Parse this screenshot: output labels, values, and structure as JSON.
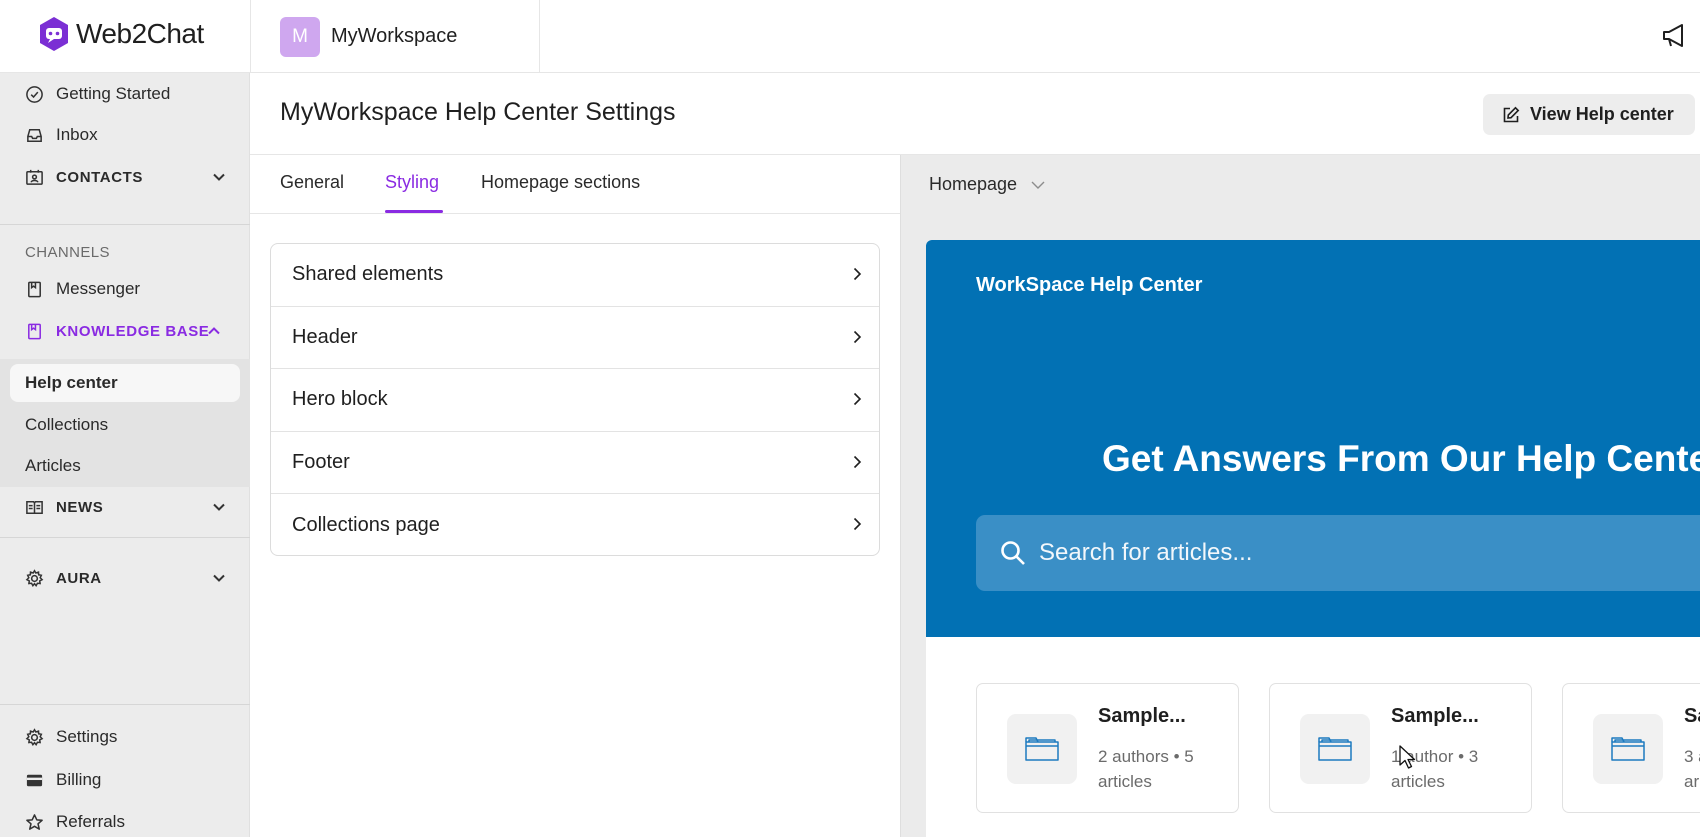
{
  "brand": {
    "logo_text": "Web2Chat",
    "accent": "#8a2be2"
  },
  "workspace": {
    "avatar_letter": "M",
    "name": "MyWorkspace",
    "avatar_color": "#cfa7ef"
  },
  "sidebar": {
    "items": [
      {
        "label": "Getting Started",
        "icon": "check-circle-icon"
      },
      {
        "label": "Inbox",
        "icon": "inbox-icon"
      },
      {
        "label": "CONTACTS",
        "icon": "contacts-icon"
      }
    ],
    "channels_label": "CHANNELS",
    "messenger": {
      "label": "Messenger",
      "icon": "book-icon"
    },
    "knowledge_base": {
      "label": "KNOWLEDGE BASE",
      "icon": "book-icon"
    },
    "kb_sub": [
      {
        "label": "Help center",
        "active": true
      },
      {
        "label": "Collections",
        "active": false
      },
      {
        "label": "Articles",
        "active": false
      }
    ],
    "news": {
      "label": "NEWS",
      "icon": "newspaper-icon"
    },
    "aura": {
      "label": "AURA",
      "icon": "gear-icon"
    },
    "bottom": [
      {
        "label": "Settings",
        "icon": "gear-icon"
      },
      {
        "label": "Billing",
        "icon": "credit-card-icon"
      },
      {
        "label": "Referrals",
        "icon": "star-icon"
      }
    ]
  },
  "header": {
    "title": "MyWorkspace Help Center Settings",
    "view_button": "View Help center"
  },
  "tabs": [
    {
      "label": "General",
      "active": false
    },
    {
      "label": "Styling",
      "active": true
    },
    {
      "label": "Homepage sections",
      "active": false
    }
  ],
  "accordion": [
    "Shared elements",
    "Header",
    "Hero block",
    "Footer",
    "Collections page"
  ],
  "preview": {
    "page_select": "Homepage",
    "brand_name": "WorkSpace Help Center",
    "hero_title": "Get Answers From Our Help Center",
    "search_placeholder": "Search for articles...",
    "hero_color": "#0271b4",
    "cards": [
      {
        "title": "Sample...",
        "meta": "2 authors • 5 articles"
      },
      {
        "title": "Sample...",
        "meta": "1 author • 3 articles"
      },
      {
        "title": "Sa",
        "meta": "3 a ar"
      }
    ]
  }
}
